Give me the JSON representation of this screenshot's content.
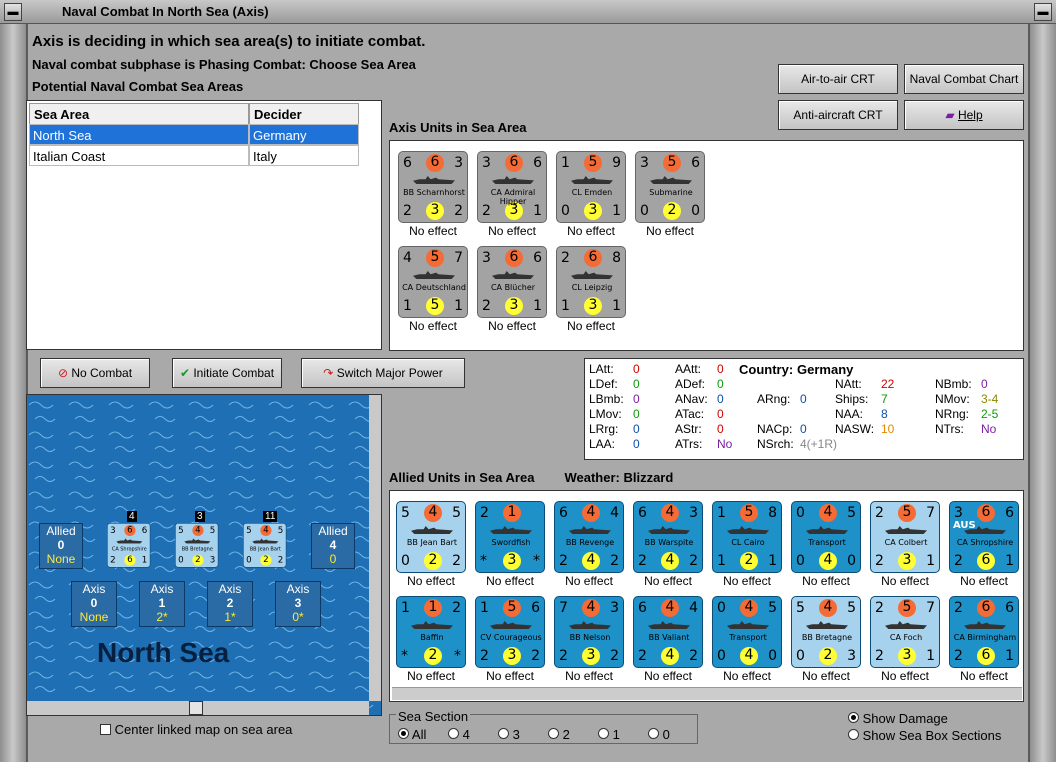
{
  "window": {
    "title": "Naval Combat In North Sea (Axis)"
  },
  "header": {
    "line1": "Axis is deciding in which sea area(s) to initiate combat.",
    "line2": "Naval combat subphase is Phasing Combat: Choose Sea Area",
    "line3": "Potential Naval Combat Sea Areas"
  },
  "buttons": {
    "air_crt": "Air-to-air CRT",
    "naval_chart": "Naval Combat Chart",
    "aa_crt": "Anti-aircraft CRT",
    "help": "Help",
    "no_combat": "No Combat",
    "initiate": "Initiate Combat",
    "switch": "Switch Major Power"
  },
  "table": {
    "headers": [
      "Sea Area",
      "Decider"
    ],
    "rows": [
      [
        "North Sea",
        "Germany"
      ],
      [
        "Italian Coast",
        "Italy"
      ]
    ]
  },
  "axis_section": "Axis Units in Sea Area",
  "allied_section": "Allied Units in Sea Area",
  "weather_label": "Weather:",
  "weather": "Blizzard",
  "axis_units": [
    {
      "tl": "6",
      "tm": "6",
      "tr": "3",
      "name": "BB Scharnhorst",
      "bl": "2",
      "bm": "3",
      "br": "2",
      "effect": "No effect"
    },
    {
      "tl": "3",
      "tm": "6",
      "tr": "6",
      "name": "CA Admiral Hipper",
      "bl": "2",
      "bm": "3",
      "br": "1",
      "effect": "No effect"
    },
    {
      "tl": "1",
      "tm": "5",
      "tr": "9",
      "name": "CL Emden",
      "bl": "0",
      "bm": "3",
      "br": "1",
      "effect": "No effect"
    },
    {
      "tl": "3",
      "tm": "5",
      "tr": "6",
      "name": "Submarine",
      "bl": "0",
      "bm": "2",
      "br": "0",
      "effect": "No effect"
    },
    {
      "tl": "4",
      "tm": "5",
      "tr": "7",
      "name": "CA Deutschland",
      "bl": "1",
      "bm": "5",
      "br": "1",
      "effect": "No effect"
    },
    {
      "tl": "3",
      "tm": "6",
      "tr": "6",
      "name": "CA Blücher",
      "bl": "2",
      "bm": "3",
      "br": "1",
      "effect": "No effect"
    },
    {
      "tl": "2",
      "tm": "6",
      "tr": "8",
      "name": "CL Leipzig",
      "bl": "1",
      "bm": "3",
      "br": "1",
      "effect": "No effect"
    }
  ],
  "info": {
    "latt": "LAtt:",
    "latt_v": "0",
    "ldef": "LDef:",
    "ldef_v": "0",
    "lbmb": "LBmb:",
    "lbmb_v": "0",
    "lmov": "LMov:",
    "lmov_v": "0",
    "lrg": "LRrg:",
    "lrg_v": "0",
    "laa": "LAA:",
    "laa_v": "0",
    "aatt": "AAtt:",
    "aatt_v": "0",
    "adef": "ADef:",
    "adef_v": "0",
    "anav": "ANav:",
    "anav_v": "0",
    "atac": "ATac:",
    "atac_v": "0",
    "astr": "AStr:",
    "astr_v": "0",
    "atrs": "ATrs:",
    "atrs_v": "No",
    "country": "Country:",
    "country_v": "Germany",
    "arng": "ARng:",
    "arng_v": "0",
    "nacp": "NACp:",
    "nacp_v": "0",
    "nsrch": "NSrch:",
    "nsrch_v": "4(+1R)",
    "natt": "NAtt:",
    "natt_v": "22",
    "ships": "Ships:",
    "ships_v": "7",
    "naa": "NAA:",
    "naa_v": "8",
    "nasw": "NASW:",
    "nasw_v": "10",
    "nbmb": "NBmb:",
    "nbmb_v": "0",
    "nmov": "NMov:",
    "nmov_v": "3-4",
    "nrng": "NRng:",
    "nrng_v": "2-5",
    "ntrs": "NTrs:",
    "ntrs_v": "No"
  },
  "allied_units": [
    {
      "tl": "5",
      "tm": "4",
      "tr": "5",
      "name": "BB Jean Bart",
      "bl": "0",
      "bm": "2",
      "br": "2",
      "effect": "No effect",
      "style": "light"
    },
    {
      "tl": "2",
      "tm": "1",
      "tr": "",
      "name": "Swordfish",
      "bl": "*",
      "bm": "3",
      "br": "*",
      "effect": "No effect",
      "style": "air"
    },
    {
      "tl": "6",
      "tm": "4",
      "tr": "4",
      "name": "BB Revenge",
      "bl": "2",
      "bm": "4",
      "br": "2",
      "effect": "No effect",
      "style": "dark"
    },
    {
      "tl": "6",
      "tm": "4",
      "tr": "3",
      "name": "BB Warspite",
      "bl": "2",
      "bm": "4",
      "br": "2",
      "effect": "No effect",
      "style": "dark"
    },
    {
      "tl": "1",
      "tm": "5",
      "tr": "8",
      "name": "CL Cairo",
      "bl": "1",
      "bm": "2",
      "br": "1",
      "effect": "No effect",
      "style": "dark"
    },
    {
      "tl": "0",
      "tm": "4",
      "tr": "5",
      "name": "Transport",
      "bl": "0",
      "bm": "4",
      "br": "0",
      "effect": "No effect",
      "style": "dark"
    },
    {
      "tl": "2",
      "tm": "5",
      "tr": "7",
      "name": "CA Colbert",
      "bl": "2",
      "bm": "3",
      "br": "1",
      "effect": "No effect",
      "style": "light"
    },
    {
      "tl": "3",
      "tm": "6",
      "tr": "6",
      "name": "CA Shropshire",
      "bl": "2",
      "bm": "6",
      "br": "1",
      "effect": "No effect",
      "style": "dark",
      "tag": "AUS"
    },
    {
      "tl": "1",
      "tm": "1",
      "tr": "2",
      "name": "Baffin",
      "bl": "*",
      "bm": "2",
      "br": "*",
      "effect": "No effect",
      "style": "air"
    },
    {
      "tl": "1",
      "tm": "5",
      "tr": "6",
      "name": "CV Courageous",
      "bl": "2",
      "bm": "3",
      "br": "2",
      "effect": "No effect",
      "style": "dark"
    },
    {
      "tl": "7",
      "tm": "4",
      "tr": "3",
      "name": "BB Nelson",
      "bl": "2",
      "bm": "3",
      "br": "2",
      "effect": "No effect",
      "style": "dark"
    },
    {
      "tl": "6",
      "tm": "4",
      "tr": "4",
      "name": "BB Valiant",
      "bl": "2",
      "bm": "4",
      "br": "2",
      "effect": "No effect",
      "style": "dark"
    },
    {
      "tl": "0",
      "tm": "4",
      "tr": "5",
      "name": "Transport",
      "bl": "0",
      "bm": "4",
      "br": "0",
      "effect": "No effect",
      "style": "dark"
    },
    {
      "tl": "5",
      "tm": "4",
      "tr": "5",
      "name": "BB Bretagne",
      "bl": "0",
      "bm": "2",
      "br": "3",
      "effect": "No effect",
      "style": "light"
    },
    {
      "tl": "2",
      "tm": "5",
      "tr": "7",
      "name": "CA Foch",
      "bl": "2",
      "bm": "3",
      "br": "1",
      "effect": "No effect",
      "style": "light"
    },
    {
      "tl": "2",
      "tm": "6",
      "tr": "6",
      "name": "CA Birmingham",
      "bl": "2",
      "bm": "6",
      "br": "1",
      "effect": "No effect",
      "style": "dark"
    }
  ],
  "map": {
    "name": "North Sea",
    "allied_label": "Allied",
    "allied_left": "0",
    "allied_left_sub": "None",
    "allied_right": "4",
    "allied_right_sub": "0",
    "axis_boxes": [
      {
        "label": "Axis",
        "n": "0",
        "sub": "None"
      },
      {
        "label": "Axis",
        "n": "1",
        "sub": "2*"
      },
      {
        "label": "Axis",
        "n": "2",
        "sub": "1*"
      },
      {
        "label": "Axis",
        "n": "3",
        "sub": "0*"
      }
    ],
    "mini": [
      {
        "top": "4",
        "tl": "3",
        "tm": "6",
        "tr": "6",
        "name": "CA Shropshire",
        "bl": "2",
        "bm": "6",
        "br": "1",
        "tag": "AUS"
      },
      {
        "top": "3",
        "tl": "5",
        "tm": "4",
        "tr": "5",
        "name": "BB Bretagne",
        "bl": "0",
        "bm": "2",
        "br": "3"
      },
      {
        "top": "11",
        "tl": "5",
        "tm": "4",
        "tr": "5",
        "name": "BB Jean Bart",
        "bl": "0",
        "bm": "2",
        "br": "2"
      }
    ]
  },
  "center_linked": "Center linked map on sea area",
  "sea_section": {
    "label": "Sea Section",
    "options": [
      "All",
      "4",
      "3",
      "2",
      "1",
      "0"
    ]
  },
  "show_damage": "Show Damage",
  "show_boxes": "Show Sea Box Sections"
}
